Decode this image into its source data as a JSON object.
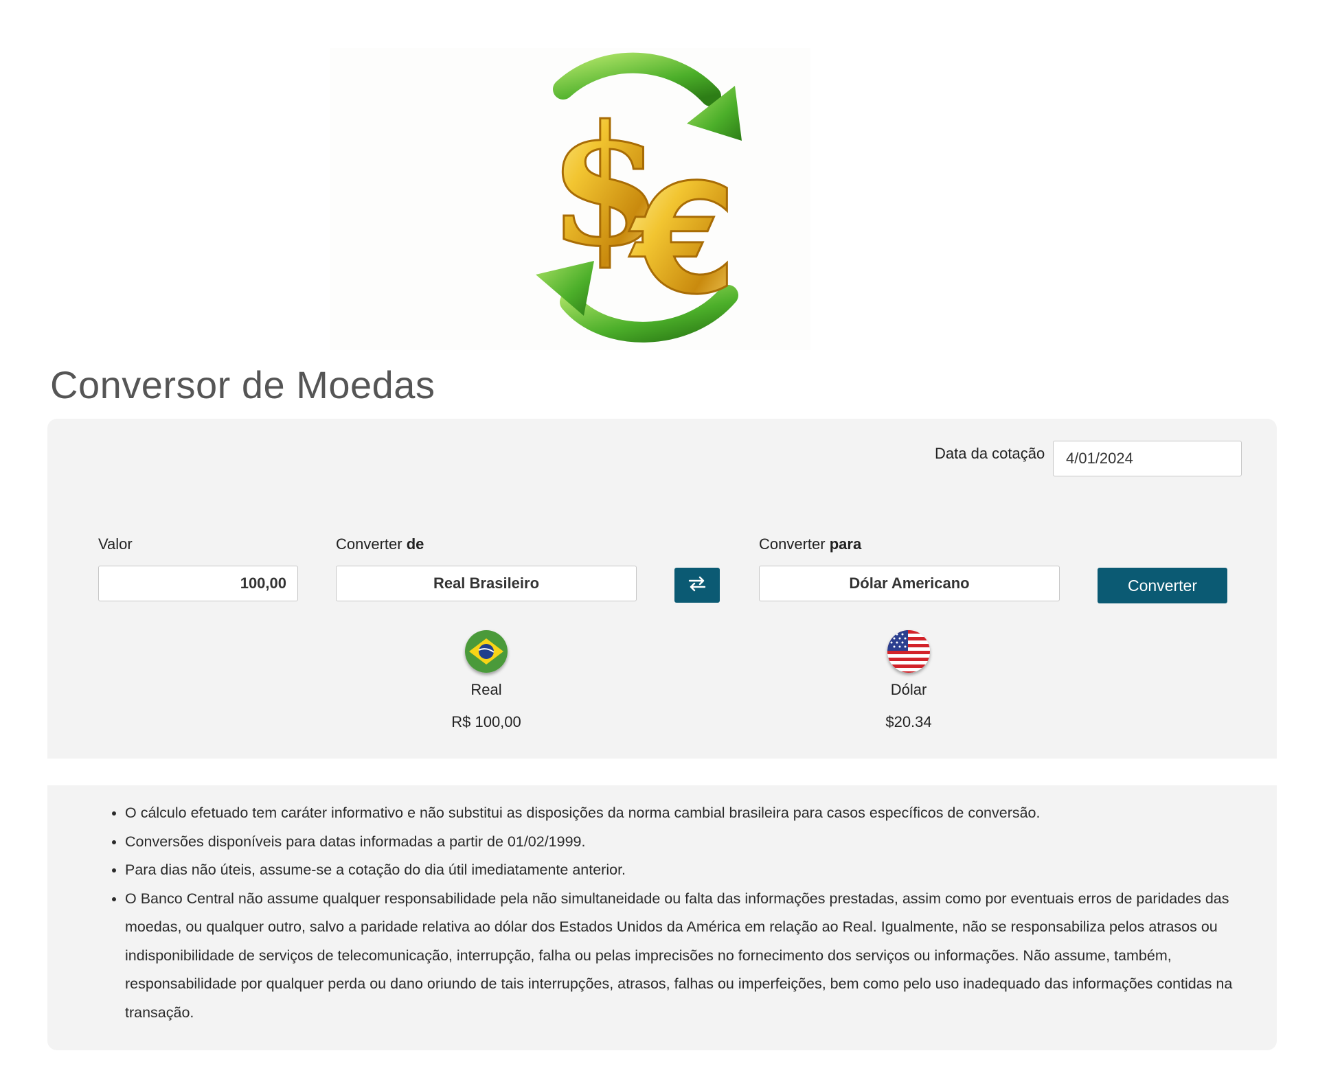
{
  "page": {
    "title": "Conversor de Moedas"
  },
  "quote_date": {
    "label": "Data da cotação",
    "value": "4/01/2024"
  },
  "form": {
    "amount_label": "Valor",
    "amount_value": "100,00",
    "from_label_prefix": "Converter ",
    "from_label_bold": "de",
    "from_currency": "Real Brasileiro",
    "swap_icon": "swap-arrows-icon",
    "to_label_prefix": "Converter ",
    "to_label_bold": "para",
    "to_currency": "Dólar Americano",
    "convert_button": "Converter"
  },
  "result": {
    "from": {
      "flag_icon": "brazil-flag-icon",
      "name": "Real",
      "amount": "R$ 100,00"
    },
    "to": {
      "flag_icon": "usa-flag-icon",
      "name": "Dólar",
      "amount": "$20.34"
    }
  },
  "notes": [
    "O cálculo efetuado tem caráter informativo e não substitui as disposições da norma cambial brasileira para casos específicos de conversão.",
    "Conversões disponíveis para datas informadas a partir de 01/02/1999.",
    "Para dias não úteis, assume-se a cotação do dia útil imediatamente anterior.",
    "O Banco Central não assume qualquer responsabilidade pela não simultaneidade ou falta das informações prestadas, assim como por eventuais erros de paridades das moedas, ou qualquer outro, salvo a paridade relativa ao dólar dos Estados Unidos da América em relação ao Real. Igualmente, não se responsabiliza pelos atrasos ou indisponibilidade de serviços de telecomunicação, interrupção, falha ou pelas imprecisões no fornecimento dos serviços ou informações. Não assume, também, responsabilidade por qualquer perda ou dano oriundo de tais interrupções, atrasos, falhas ou imperfeições, bem como pelo uso inadequado das informações contidas na transação."
  ],
  "colors": {
    "primary_button": "#0b5a73",
    "panel_background": "#f3f3f3",
    "title_text": "#555555"
  }
}
